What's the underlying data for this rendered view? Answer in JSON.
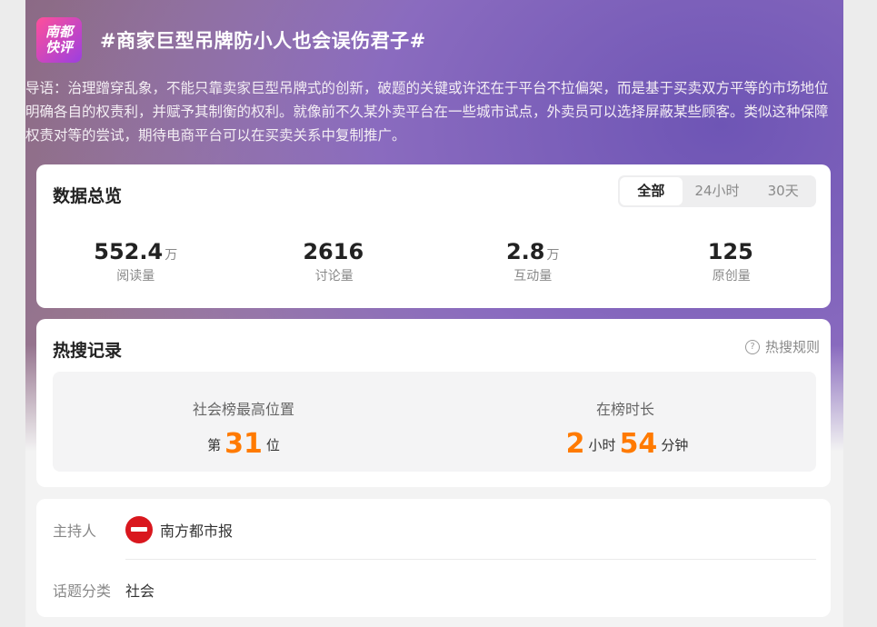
{
  "header": {
    "logo_line1": "南都",
    "logo_line2": "快评",
    "title": "#商家巨型吊牌防小人也会误伤君子#"
  },
  "intro": "导语：治理蹭穿乱象，不能只靠卖家巨型吊牌式的创新，破题的关键或许还在于平台不拉偏架，而是基于买卖双方平等的市场地位明确各自的权责利，并赋予其制衡的权利。就像前不久某外卖平台在一些城市试点，外卖员可以选择屏蔽某些顾客。类似这种保障权责对等的尝试，期待电商平台可以在买卖关系中复制推广。",
  "overview": {
    "title": "数据总览",
    "tabs": [
      "全部",
      "24小时",
      "30天"
    ],
    "active_tab": "全部",
    "stats": [
      {
        "value": "552.4",
        "unit": "万",
        "label": "阅读量"
      },
      {
        "value": "2616",
        "unit": "",
        "label": "讨论量"
      },
      {
        "value": "2.8",
        "unit": "万",
        "label": "互动量"
      },
      {
        "value": "125",
        "unit": "",
        "label": "原创量"
      }
    ]
  },
  "hot": {
    "title": "热搜记录",
    "rules_label": "热搜规则",
    "rank": {
      "label": "社会榜最高位置",
      "prefix": "第",
      "value": "31",
      "suffix": "位"
    },
    "duration": {
      "label": "在榜时长",
      "hours": "2",
      "hours_unit": "小时",
      "minutes": "54",
      "minutes_unit": "分钟"
    }
  },
  "info": {
    "host_label": "主持人",
    "host_name": "南方都市报",
    "category_label": "话题分类",
    "category_value": "社会"
  },
  "colors": {
    "accent": "#ff7a00",
    "avatar": "#d9171e"
  }
}
